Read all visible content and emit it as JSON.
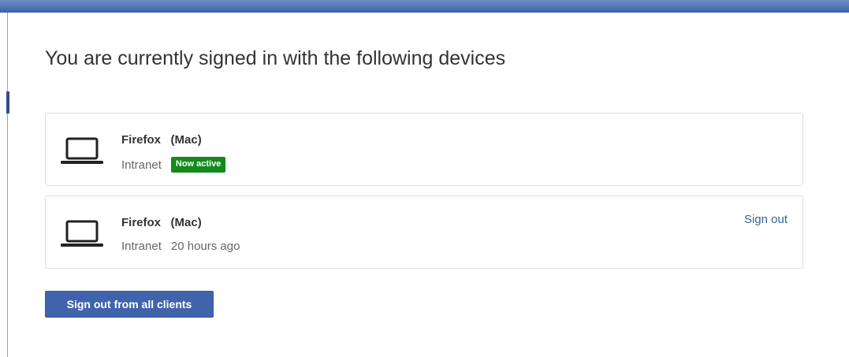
{
  "page": {
    "title": "You are currently signed in with the following devices"
  },
  "sessions": [
    {
      "browser": "Firefox",
      "os": "(Mac)",
      "client": "Intranet",
      "status_badge": "Now active",
      "icon": "laptop-icon"
    },
    {
      "browser": "Firefox",
      "os": "(Mac)",
      "client": "Intranet",
      "last_access": "20 hours ago",
      "sign_out_label": "Sign out",
      "icon": "laptop-icon"
    }
  ],
  "actions": {
    "sign_out_all_label": "Sign out from all clients"
  },
  "colors": {
    "header_bar": "#3d63a8",
    "badge_active": "#138a1b",
    "primary_button": "#3f64ab",
    "link": "#3d5e9c"
  }
}
